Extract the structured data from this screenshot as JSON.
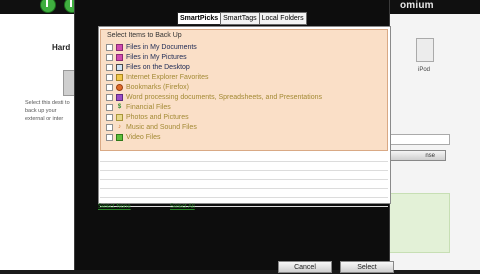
{
  "background_app": {
    "brand_text": "omium",
    "left_panel": {
      "heading": "Hard",
      "description": "Select this desti to back up your external or inter"
    },
    "right_panel": {
      "device_label": "iPod",
      "button_label": "nse"
    }
  },
  "dialog": {
    "tabs": [
      {
        "label": "SmartPicks",
        "active": true
      },
      {
        "label": "SmartTags",
        "active": false
      },
      {
        "label": "Local Folders",
        "active": false
      }
    ],
    "list_header": "Select Items to Back Up",
    "items": [
      {
        "label": "Files in My Documents",
        "icon": "documents-folder-icon",
        "style": "dark"
      },
      {
        "label": "Files in My Pictures",
        "icon": "pictures-folder-icon",
        "style": "dark"
      },
      {
        "label": "Files on the Desktop",
        "icon": "desktop-icon",
        "style": "dark"
      },
      {
        "label": "Internet Explorer Favorites",
        "icon": "ie-favorites-icon",
        "style": "gold"
      },
      {
        "label": "Bookmarks (Firefox)",
        "icon": "firefox-bookmarks-icon",
        "style": "gold"
      },
      {
        "label": "Word processing documents, Spreadsheets, and Presentations",
        "icon": "office-documents-icon",
        "style": "gold"
      },
      {
        "label": "Financial Files",
        "icon": "financial-files-icon",
        "style": "gold"
      },
      {
        "label": "Photos and Pictures",
        "icon": "photos-icon",
        "style": "gold"
      },
      {
        "label": "Music and Sound Files",
        "icon": "music-icon",
        "style": "gold"
      },
      {
        "label": "Video Files",
        "icon": "video-icon",
        "style": "gold"
      }
    ],
    "select_none_label": "Select None",
    "select_all_label": "Select All",
    "cancel_label": "Cancel",
    "select_label": "Select"
  }
}
